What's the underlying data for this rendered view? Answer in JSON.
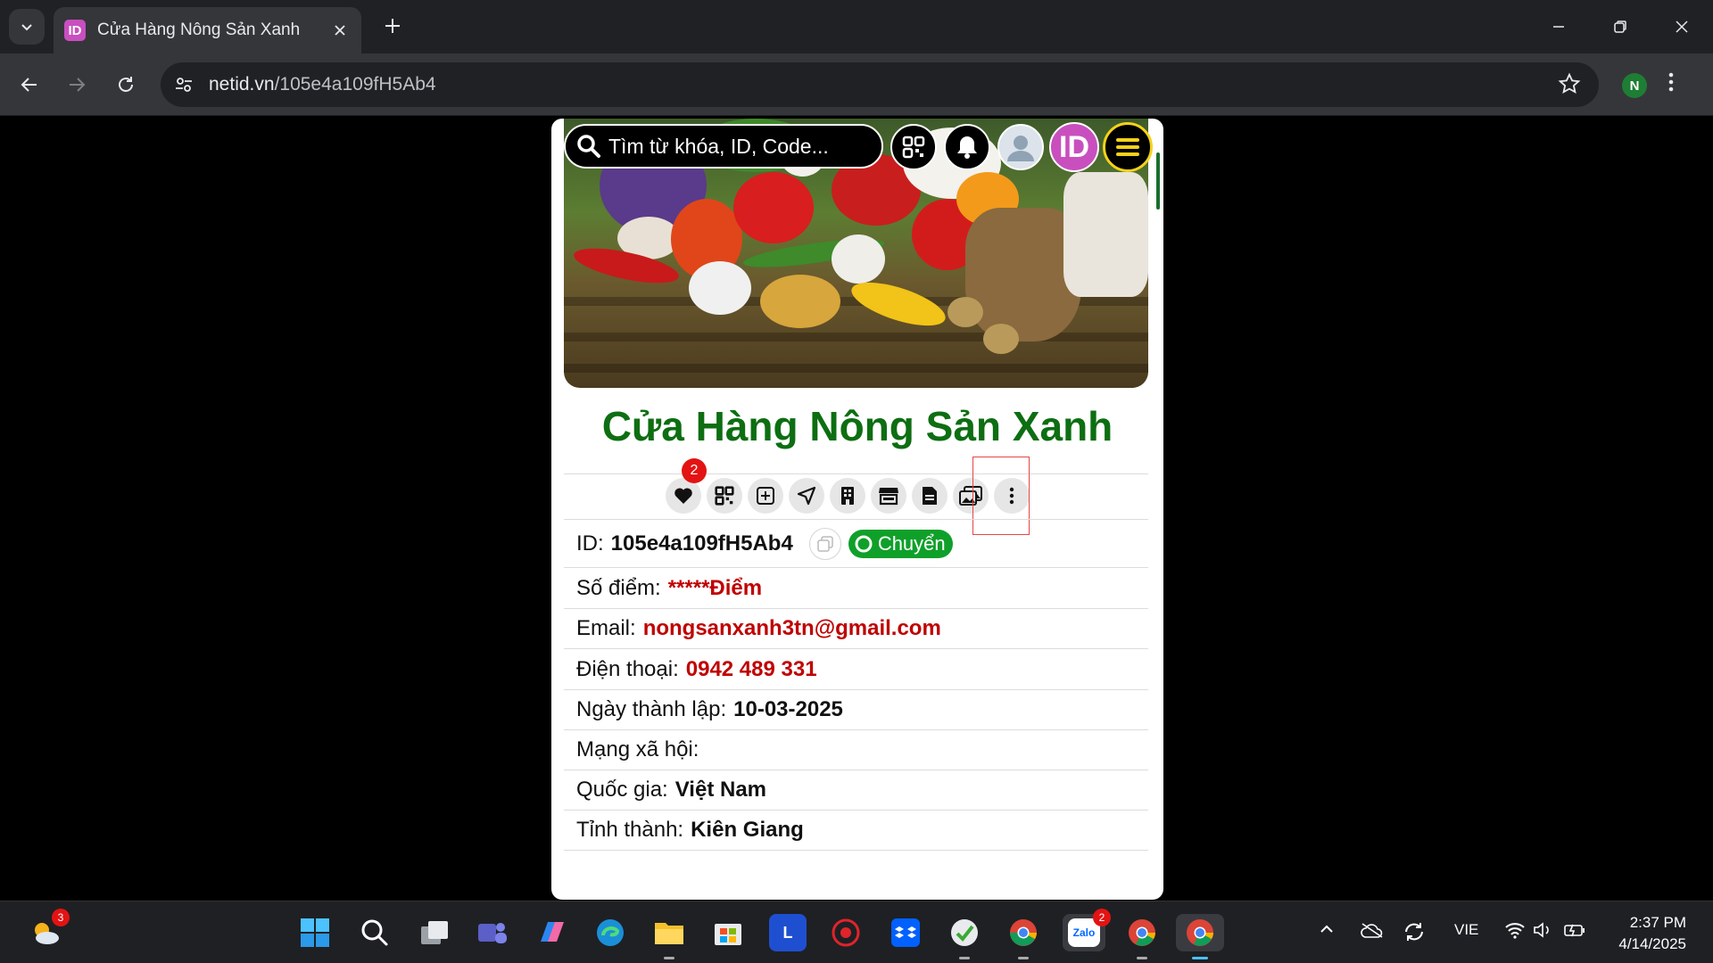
{
  "browser": {
    "tab_title": "Cửa Hàng Nông Sản Xanh",
    "tab_favicon_text": "ID",
    "url_host": "netid.vn",
    "url_path": "/105e4a109fH5Ab4",
    "profile_initial": "N"
  },
  "page": {
    "search_placeholder": "Tìm từ khóa, ID, Code...",
    "logo_text": "ID",
    "shop_title": "Cửa Hàng Nông Sản Xanh",
    "favorites_badge": "2",
    "info": {
      "id_label": "ID:",
      "id_value": "105e4a109fH5Ab4",
      "transfer_label": "Chuyển",
      "points_label": "Số điểm:",
      "points_value": "*****Điểm",
      "email_label": "Email:",
      "email_value": "nongsanxanh3tn@gmail.com",
      "phone_label": "Điện thoại:",
      "phone_value": "0942 489 331",
      "founded_label": "Ngày thành lập:",
      "founded_value": "10-03-2025",
      "social_label": "Mạng xã hội:",
      "country_label": "Quốc gia:",
      "country_value": "Việt Nam",
      "province_label": "Tỉnh thành:",
      "province_value": "Kiên Giang"
    },
    "action_icons": [
      "heart-icon",
      "qr-code-icon",
      "plus-square-icon",
      "location-arrow-icon",
      "building-icon",
      "store-icon",
      "document-icon",
      "images-icon",
      "more-vertical-icon"
    ]
  },
  "taskbar": {
    "weather_badge": "3",
    "zalo_badge": "2",
    "zalo_label": "Zalo",
    "l_app_label": "L",
    "language": "VIE",
    "time": "2:37 PM",
    "date": "4/14/2025"
  },
  "colors": {
    "title_green": "#0d6e12",
    "value_red": "#c00000",
    "logo_purple": "#c94fbf",
    "transfer_green": "#0fa02a"
  }
}
